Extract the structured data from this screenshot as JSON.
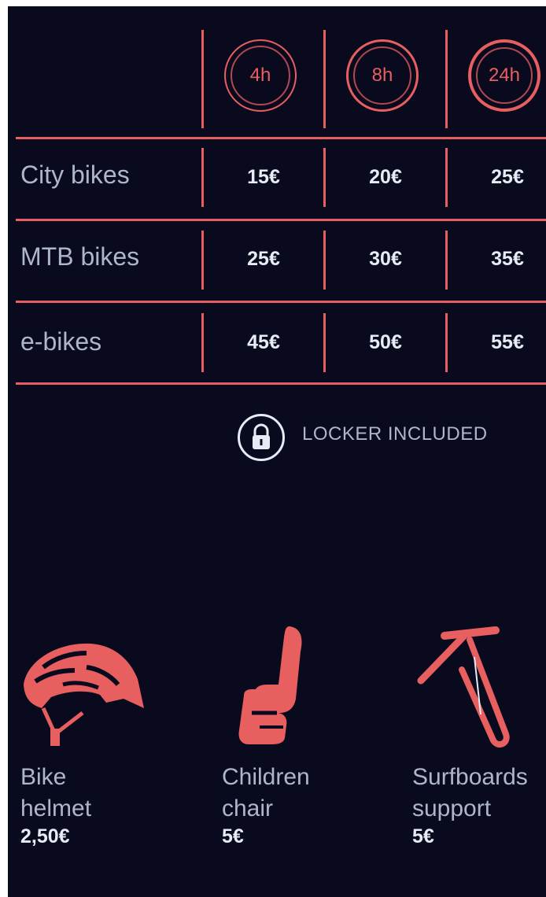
{
  "durations": [
    "4h",
    "8h",
    "24h"
  ],
  "rows": [
    {
      "label": "City bikes",
      "prices": [
        "15€",
        "20€",
        "25€"
      ]
    },
    {
      "label": "MTB bikes",
      "prices": [
        "25€",
        "30€",
        "35€"
      ]
    },
    {
      "label": "e-bikes",
      "prices": [
        "45€",
        "50€",
        "55€"
      ]
    }
  ],
  "locker": {
    "text": "LOCKER INCLUDED",
    "icon": "lock-icon"
  },
  "accessories": [
    {
      "line1": "Bike",
      "line2": "helmet",
      "price": "2,50€",
      "icon": "helmet-icon"
    },
    {
      "line1": "Children",
      "line2": "chair",
      "price": "5€",
      "icon": "child-seat-icon"
    },
    {
      "line1": "Surfboards",
      "line2": "support",
      "price": "5€",
      "icon": "surfboard-rack-icon"
    }
  ],
  "colors": {
    "background": "#0a0a1e",
    "accent": "#e85f60",
    "text": "#e6ebf5",
    "muted": "#aeb6cc"
  }
}
